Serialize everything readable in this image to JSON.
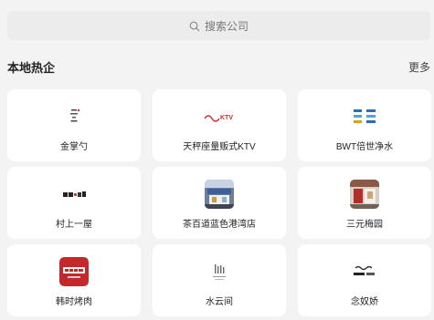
{
  "search": {
    "placeholder": "搜索公司",
    "icon": "search-icon"
  },
  "section": {
    "title": "本地热企",
    "more": "更多"
  },
  "companies": [
    {
      "name": "金掌勺",
      "logo": "jinzhangshao-logo"
    },
    {
      "name": "天秤座量贩式KTV",
      "logo": "ktv-logo"
    },
    {
      "name": "BWT倍世净水",
      "logo": "bwt-logo"
    },
    {
      "name": "村上一屋",
      "logo": "cunshangyiwu-logo"
    },
    {
      "name": "茶百道蓝色港湾店",
      "logo": "chabaidao-store-photo"
    },
    {
      "name": "三元梅园",
      "logo": "sanyuanmeiyuan-store-photo"
    },
    {
      "name": "韩时烤肉",
      "logo": "hanshi-bbq-logo"
    },
    {
      "name": "水云间",
      "logo": "shuiyunjian-logo"
    },
    {
      "name": "念奴娇",
      "logo": "niannujiao-logo"
    }
  ],
  "colors": {
    "background": "#f3f3f3",
    "card": "#ffffff",
    "ktv_red": "#d6262b",
    "hanshi_red": "#c5282b"
  }
}
